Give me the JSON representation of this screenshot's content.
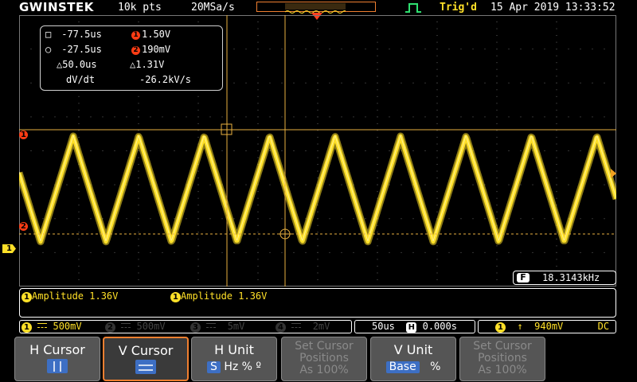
{
  "header": {
    "brand": "GWINSTEK",
    "record_length": "10k pts",
    "sample_rate": "20MSa/s",
    "trigger_status": "Trig'd",
    "datetime": "15 Apr 2019 13:33:52",
    "trigger_status_color": "#ffe028"
  },
  "cursor_readout": {
    "h1_time": "-77.5us",
    "h2_time": "-27.5us",
    "delta_time": "50.0us",
    "v1_value": "1.50V",
    "v2_value": "190mV",
    "delta_value": "1.31V",
    "dvdt_label": "dV/dt",
    "dvdt_value": "-26.2kV/s",
    "v1_badge": "1",
    "v2_badge": "2"
  },
  "markers": {
    "cursor1_label": "1",
    "cursor2_label": "2",
    "channel1_label": "1"
  },
  "frequency": {
    "label": "F",
    "value": "18.3143kHz"
  },
  "measurements": [
    {
      "channel": "1",
      "text": "Amplitude 1.36V"
    },
    {
      "channel": "1",
      "text": "Amplitude 1.36V"
    }
  ],
  "channels": [
    {
      "num": "1",
      "scale": "500mV",
      "active": true
    },
    {
      "num": "2",
      "scale": "500mV",
      "active": false
    },
    {
      "num": "3",
      "scale": "5mV",
      "active": false
    },
    {
      "num": "4",
      "scale": "2mV",
      "active": false
    }
  ],
  "timebase": {
    "scale": "50us",
    "h_label": "H",
    "position": "0.000s"
  },
  "trigger": {
    "channel": "1",
    "slope_icon": "rising-edge-icon",
    "level": "940mV",
    "coupling": "DC"
  },
  "softkeys": [
    {
      "title": "H Cursor",
      "icon": "h-cursor-icon",
      "active": false,
      "disabled": false
    },
    {
      "title": "V Cursor",
      "icon": "v-cursor-icon",
      "active": true,
      "disabled": false
    },
    {
      "title": "H Unit",
      "options": [
        "S",
        "Hz",
        "%",
        "º"
      ],
      "selected": "S",
      "active": false,
      "disabled": false
    },
    {
      "title": "Set Cursor",
      "line2": "Positions",
      "line3": "As 100%",
      "active": false,
      "disabled": true
    },
    {
      "title": "V Unit",
      "options": [
        "Base",
        "%"
      ],
      "selected": "Base",
      "active": false,
      "disabled": false
    },
    {
      "title": "Set Cursor",
      "line2": "Positions",
      "line3": "As 100%",
      "active": false,
      "disabled": true
    }
  ],
  "colors": {
    "channel1": "#ffe028",
    "cursor": "#e8b040",
    "accent": "#f07f30",
    "marker_red": "#ff3c14",
    "unit_highlight": "#3d6fc4"
  },
  "waveform": {
    "type": "triangle",
    "frequency_hz": 18314.3,
    "high_v": 1.5,
    "low_v": 0.19,
    "timebase_s_per_div": 5e-05
  }
}
